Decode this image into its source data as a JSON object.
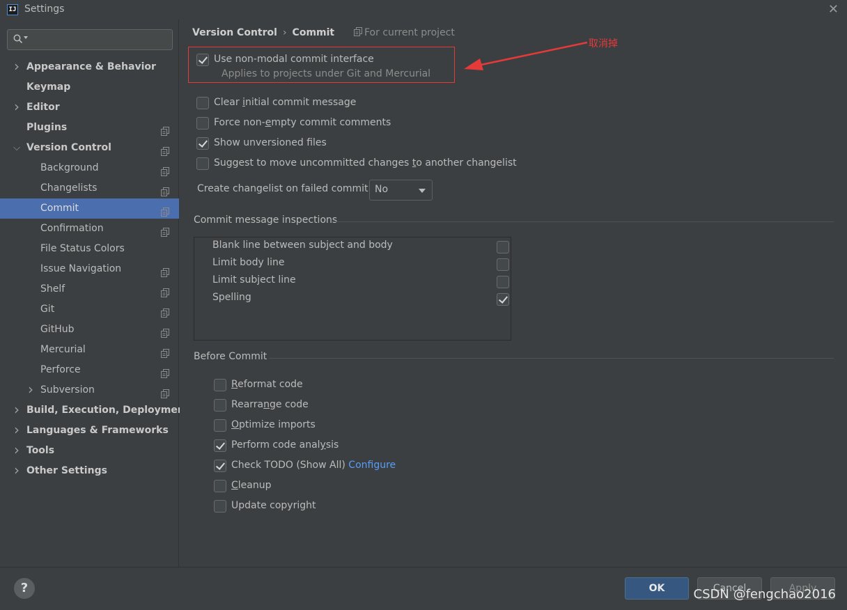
{
  "window": {
    "title": "Settings",
    "app_icon": "IJ"
  },
  "search": {
    "placeholder": ""
  },
  "sidebar": {
    "items": [
      {
        "label": "Appearance & Behavior",
        "level": 0,
        "expandable": true,
        "expanded": false,
        "project": false
      },
      {
        "label": "Keymap",
        "level": 0,
        "expandable": false,
        "project": false
      },
      {
        "label": "Editor",
        "level": 0,
        "expandable": true,
        "expanded": false,
        "project": false
      },
      {
        "label": "Plugins",
        "level": 0,
        "expandable": false,
        "project": true
      },
      {
        "label": "Version Control",
        "level": 0,
        "expandable": true,
        "expanded": true,
        "project": true
      },
      {
        "label": "Background",
        "level": 1,
        "expandable": false,
        "project": true
      },
      {
        "label": "Changelists",
        "level": 1,
        "expandable": false,
        "project": true
      },
      {
        "label": "Commit",
        "level": 1,
        "expandable": false,
        "project": true,
        "selected": true
      },
      {
        "label": "Confirmation",
        "level": 1,
        "expandable": false,
        "project": true
      },
      {
        "label": "File Status Colors",
        "level": 1,
        "expandable": false,
        "project": false
      },
      {
        "label": "Issue Navigation",
        "level": 1,
        "expandable": false,
        "project": true
      },
      {
        "label": "Shelf",
        "level": 1,
        "expandable": false,
        "project": true
      },
      {
        "label": "Git",
        "level": 1,
        "expandable": false,
        "project": true
      },
      {
        "label": "GitHub",
        "level": 1,
        "expandable": false,
        "project": true
      },
      {
        "label": "Mercurial",
        "level": 1,
        "expandable": false,
        "project": true
      },
      {
        "label": "Perforce",
        "level": 1,
        "expandable": false,
        "project": true
      },
      {
        "label": "Subversion",
        "level": 1,
        "expandable": true,
        "expanded": false,
        "project": true
      },
      {
        "label": "Build, Execution, Deployment",
        "level": 0,
        "expandable": true,
        "expanded": false,
        "project": false
      },
      {
        "label": "Languages & Frameworks",
        "level": 0,
        "expandable": true,
        "expanded": false,
        "project": false
      },
      {
        "label": "Tools",
        "level": 0,
        "expandable": true,
        "expanded": false,
        "project": false
      },
      {
        "label": "Other Settings",
        "level": 0,
        "expandable": true,
        "expanded": false,
        "project": false
      }
    ]
  },
  "breadcrumb": {
    "parent": "Version Control",
    "separator": "›",
    "current": "Commit"
  },
  "scope": "For current project",
  "options": {
    "non_modal": {
      "label": "Use non-modal commit interface",
      "hint": "Applies to projects under Git and Mercurial",
      "checked": true
    },
    "clear_initial": {
      "pre": "Clear ",
      "mn": "i",
      "post": "nitial commit message",
      "checked": false
    },
    "force_nonempty": {
      "pre": "Force non-",
      "mn": "e",
      "post": "mpty commit comments",
      "checked": false
    },
    "show_unversioned": {
      "label": "Show unversioned files",
      "checked": true
    },
    "suggest_move": {
      "pre": "Suggest to move uncommitted changes ",
      "mn": "t",
      "post": "o another changelist",
      "checked": false
    }
  },
  "changelist": {
    "label": "Create changelist on failed commit:",
    "value": "No"
  },
  "inspections": {
    "title": "Commit message inspections",
    "items": [
      {
        "label": "Blank line between subject and body",
        "checked": false
      },
      {
        "label": "Limit body line",
        "checked": false
      },
      {
        "label": "Limit subject line",
        "checked": false
      },
      {
        "label": "Spelling",
        "checked": true
      }
    ]
  },
  "before_commit": {
    "title": "Before Commit",
    "items": [
      {
        "pre": "",
        "mn": "R",
        "post": "eformat code",
        "checked": false
      },
      {
        "pre": "Rearra",
        "mn": "n",
        "post": "ge code",
        "checked": false
      },
      {
        "pre": "",
        "mn": "O",
        "post": "ptimize imports",
        "checked": false
      },
      {
        "pre": "Perform code anal",
        "mn": "y",
        "post": "sis",
        "checked": true
      },
      {
        "pre": "Check TODO (Show All) ",
        "mn": "",
        "post": "",
        "checked": true,
        "link": "Configure"
      },
      {
        "pre": "",
        "mn": "C",
        "post": "leanup",
        "checked": false
      },
      {
        "pre": "Update copyright",
        "mn": "",
        "post": "",
        "checked": false
      }
    ]
  },
  "annotation": {
    "text": "取消掉",
    "color": "#e53a3a"
  },
  "footer": {
    "help": "?",
    "ok": "OK",
    "cancel": "Cancel",
    "apply": "Apply"
  },
  "watermark": "CSDN @fengchao2016",
  "colors": {
    "selection": "#4b6eaf",
    "ok_button": "#365880",
    "link": "#589df6",
    "annotation": "#e53a3a"
  }
}
